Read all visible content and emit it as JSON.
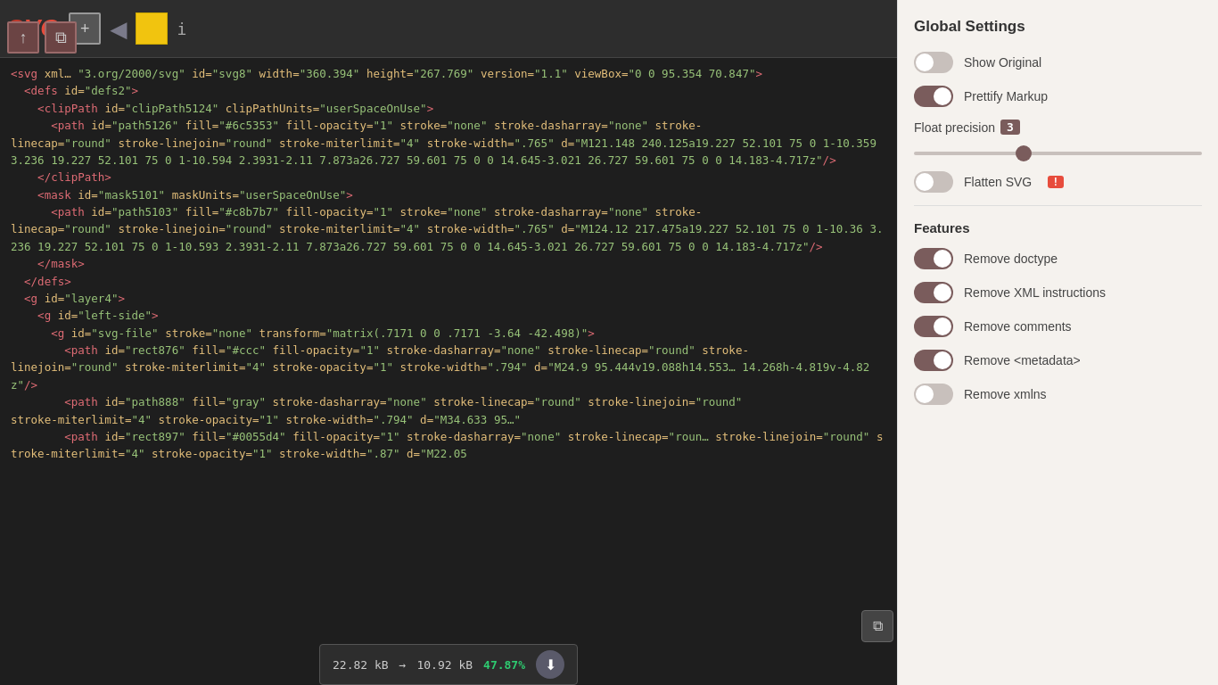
{
  "toolbar": {
    "logo": "SVG",
    "add_btn": "+",
    "arrow": "◀",
    "info": "i",
    "up_btn": "↑",
    "copy_btn": "⧉"
  },
  "code": {
    "lines": [
      "<svg xml… 3.org/2000/svg\" id=\"svg8\" width=\"360.394\" height=\"267.769\" version=\"1.1\" viewBox=\"0 0 95.354 70.847\">",
      "  <defs id=\"defs2\">",
      "    <clipPath id=\"clipPath5124\" clipPathUnits=\"userSpaceOnUse\">",
      "      <path id=\"path5126\" fill=\"#6c5353\" fill-opacity=\"1\" stroke=\"none\" stroke-dasharray=\"none\" stroke-linecap=\"round\" stroke-linejoin=\"round\" stroke-miterlimit=\"4\" stroke-width=\".765\" d=\"M121.148 240.125a19.227 52.101 75 0 1-10.359 3.236 19.227 52.101 75 0 1-10.594 2.3931-2.11 7.873a26.727 59.601 75 0 0 14.645-3.021 26.727 59.601 75 0 0 14.183-4.717z\"/>",
      "    </clipPath>",
      "    <mask id=\"mask5101\" maskUnits=\"userSpaceOnUse\">",
      "      <path id=\"path5103\" fill=\"#c8b7b7\" fill-opacity=\"1\" stroke=\"none\" stroke-dasharray=\"none\" stroke-linecap=\"round\" stroke-linejoin=\"round\" stroke-miterlimit=\"4\" stroke-width=\".765\" d=\"M124.12 217.475a19.227 52.101 75 0 1-10.36 3.236 19.227 52.101 75 0 1-10.593 2.3931-2.11 7.873a26.727 59.601 75 0 0 14.645-3.021 26.727 59.601 75 0 0 14.183-4.717z\"/>",
      "    </mask>",
      "  </defs>",
      "  <g id=\"layer4\">",
      "    <g id=\"left-side\">",
      "      <g id=\"svg-file\" stroke=\"none\" transform=\"matrix(.7171 0 0 .7171 -3.64 -42.498)\">",
      "        <path id=\"rect876\" fill=\"#ccc\" fill-opacity=\"1\" stroke-dasharray=\"none\" stroke-linecap=\"round\" stroke-linejoin=\"round\" stroke-miterlimit=\"4\" stroke-opacity=\"1\" stroke-width=\".794\" d=\"M24.9 95.444v19.088h14.553… 14.268h-4.819v-4.82z\"/>",
      "        <path id=\"path888\" fill=\"gray\" stroke-dasharray=\"none\" stroke-linecap=\"round\" stroke-linejoin=\"round\" stroke-miterlimit=\"4\" stroke-opacity=\"1\" stroke-width=\".794\" d=\"M34.633 95…",
      "        <path id=\"rect897\" fill=\"#0055d4\" fill-opacity=\"1\" stroke-dasharray=\"none\" stroke-linecap=\"roun… stroke-linejoin=\"round\" stroke-miterlimit=\"4\" stroke-opacity=\"1\" stroke-width=\".87\" d=\"M22.05"
    ]
  },
  "status": {
    "original_size": "22.82 kB",
    "arrow": "→",
    "compressed_size": "10.92 kB",
    "percent": "47.87%",
    "download_icon": "⬇"
  },
  "settings": {
    "title": "Global Settings",
    "show_original": {
      "label": "Show Original",
      "state": "off"
    },
    "prettify_markup": {
      "label": "Prettify Markup",
      "state": "on"
    },
    "float_precision": {
      "label": "Float precision",
      "value": "3",
      "slider_value": 3
    },
    "flatten_svg": {
      "label": "Flatten SVG",
      "state": "off",
      "warning": "!"
    },
    "features_title": "Features",
    "remove_doctype": {
      "label": "Remove doctype",
      "state": "on"
    },
    "remove_xml_instructions": {
      "label": "Remove XML instructions",
      "state": "on"
    },
    "remove_comments": {
      "label": "Remove comments",
      "state": "on"
    },
    "remove_metadata": {
      "label": "Remove <metadata>",
      "state": "on"
    },
    "remove_xmlns": {
      "label": "Remove xmlns",
      "state": "off"
    }
  }
}
